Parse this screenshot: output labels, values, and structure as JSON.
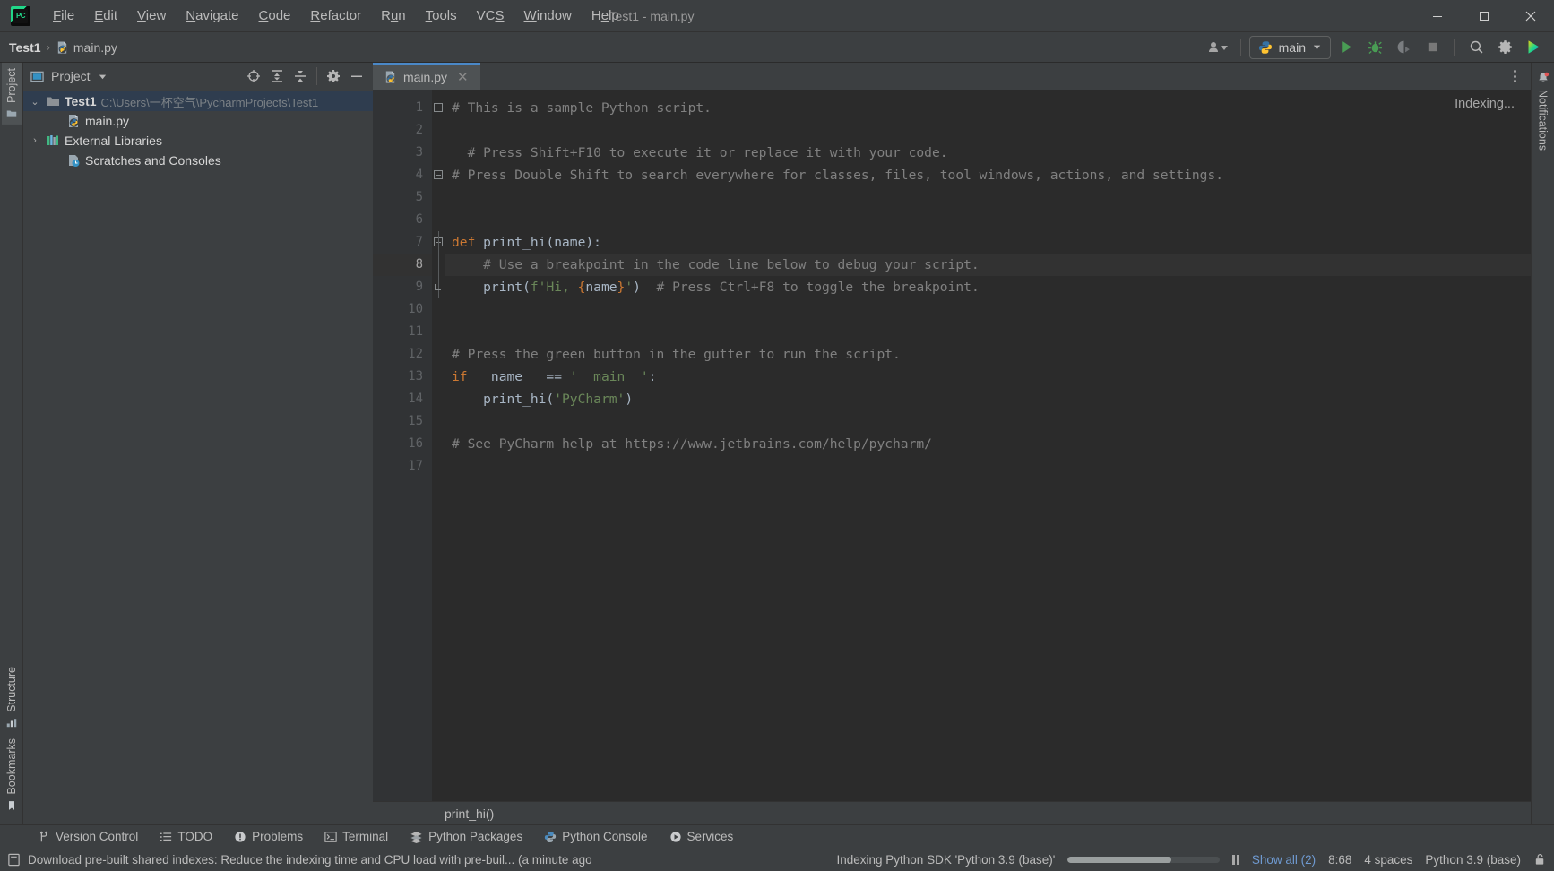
{
  "window": {
    "title": "Test1 - main.py",
    "minimize_label": "–",
    "maximize_label": "☐",
    "close_label": "✕",
    "logo_text": "PC"
  },
  "menu": {
    "items": [
      {
        "label": "File",
        "mnemonic": "F"
      },
      {
        "label": "Edit",
        "mnemonic": "E"
      },
      {
        "label": "View",
        "mnemonic": "V"
      },
      {
        "label": "Navigate",
        "mnemonic": "N"
      },
      {
        "label": "Code",
        "mnemonic": "C"
      },
      {
        "label": "Refactor",
        "mnemonic": "R"
      },
      {
        "label": "Run",
        "mnemonic": "u"
      },
      {
        "label": "Tools",
        "mnemonic": "T"
      },
      {
        "label": "VCS",
        "mnemonic": "S"
      },
      {
        "label": "Window",
        "mnemonic": "W"
      },
      {
        "label": "Help",
        "mnemonic": "H"
      }
    ]
  },
  "navbar": {
    "breadcrumb_project": "Test1",
    "breadcrumb_separator": "›",
    "breadcrumb_file": "main.py",
    "run_config": "main",
    "icons": {
      "account": "account-icon",
      "run": "run-icon",
      "debug": "debug-icon",
      "coverage": "run-with-coverage-icon",
      "stop": "stop-icon",
      "search": "search-everywhere-icon",
      "settings": "settings-icon",
      "updates": "ide-updates-icon"
    }
  },
  "left_stripe": {
    "tabs": [
      {
        "label": "Project",
        "active": true,
        "icon": "project-folder-icon"
      },
      {
        "label": "Structure",
        "active": false,
        "icon": "structure-icon"
      },
      {
        "label": "Bookmarks",
        "active": false,
        "icon": "bookmark-icon"
      }
    ]
  },
  "right_stripe": {
    "tabs": [
      {
        "label": "Notifications",
        "active": false,
        "icon": "bell-icon",
        "badge": true
      }
    ]
  },
  "project_panel": {
    "title": "Project",
    "dropdown_icon": "chevron-down-icon",
    "header_icons": [
      "select-opened-file-icon",
      "expand-all-icon",
      "collapse-all-icon",
      "gear-icon",
      "hide-icon"
    ],
    "tree": [
      {
        "name": "Test1",
        "path": "C:\\Users\\一杯空气\\PycharmProjects\\Test1",
        "arrow": "⌄",
        "selected": true,
        "bold": true,
        "indent": 0,
        "icon": "folder-icon"
      },
      {
        "name": "main.py",
        "path": "",
        "arrow": "",
        "selected": false,
        "bold": false,
        "indent": 1,
        "icon": "python-file-icon"
      },
      {
        "name": "External Libraries",
        "path": "",
        "arrow": "›",
        "selected": false,
        "bold": false,
        "indent": 0,
        "icon": "libraries-icon"
      },
      {
        "name": "Scratches and Consoles",
        "path": "",
        "arrow": "",
        "selected": false,
        "bold": false,
        "indent": 0,
        "icon": "scratches-icon"
      }
    ]
  },
  "editor": {
    "tab": {
      "label": "main.py",
      "close": "✕",
      "icon": "python-file-icon"
    },
    "indexing_text": "Indexing...",
    "bottom_breadcrumb": "print_hi()",
    "current_line": 8,
    "lines": [
      {
        "n": 1,
        "tokens": [
          {
            "t": "# This is a sample Python script.",
            "c": "cm"
          }
        ]
      },
      {
        "n": 2,
        "tokens": []
      },
      {
        "n": 3,
        "tokens": [
          {
            "t": "  # Press Shift+F10 to execute it or replace it with your code.",
            "c": "cm"
          }
        ]
      },
      {
        "n": 4,
        "tokens": [
          {
            "t": "# Press Double Shift to search everywhere for classes, files, tool windows, actions, and settings.",
            "c": "cm"
          }
        ]
      },
      {
        "n": 5,
        "tokens": []
      },
      {
        "n": 6,
        "tokens": []
      },
      {
        "n": 7,
        "tokens": [
          {
            "t": "def ",
            "c": "kw"
          },
          {
            "t": "print_hi",
            "c": "id"
          },
          {
            "t": "(name):",
            "c": "id"
          }
        ]
      },
      {
        "n": 8,
        "tokens": [
          {
            "t": "    # Use a breakpoint in the code line below to debug your script.",
            "c": "cm"
          }
        ]
      },
      {
        "n": 9,
        "tokens": [
          {
            "t": "    print(",
            "c": "id"
          },
          {
            "t": "f'Hi, ",
            "c": "st"
          },
          {
            "t": "{",
            "c": "br"
          },
          {
            "t": "name",
            "c": "id"
          },
          {
            "t": "}",
            "c": "br"
          },
          {
            "t": "'",
            "c": "st"
          },
          {
            "t": ")  ",
            "c": "id"
          },
          {
            "t": "# Press Ctrl+F8 to toggle the breakpoint.",
            "c": "cm"
          }
        ]
      },
      {
        "n": 10,
        "tokens": []
      },
      {
        "n": 11,
        "tokens": []
      },
      {
        "n": 12,
        "tokens": [
          {
            "t": "# Press the green button in the gutter to run the script.",
            "c": "cm"
          }
        ]
      },
      {
        "n": 13,
        "tokens": [
          {
            "t": "if ",
            "c": "kw"
          },
          {
            "t": "__name__ == ",
            "c": "id"
          },
          {
            "t": "'__main__'",
            "c": "st"
          },
          {
            "t": ":",
            "c": "id"
          }
        ]
      },
      {
        "n": 14,
        "tokens": [
          {
            "t": "    print_hi(",
            "c": "id"
          },
          {
            "t": "'PyCharm'",
            "c": "st"
          },
          {
            "t": ")",
            "c": "id"
          }
        ]
      },
      {
        "n": 15,
        "tokens": []
      },
      {
        "n": 16,
        "tokens": [
          {
            "t": "# See PyCharm help at https://www.jetbrains.com/help/pycharm/",
            "c": "cm"
          }
        ]
      },
      {
        "n": 17,
        "tokens": []
      }
    ]
  },
  "bottom_toolbar": {
    "items": [
      {
        "label": "Version Control",
        "icon": "vcs-branch-icon"
      },
      {
        "label": "TODO",
        "icon": "todo-list-icon"
      },
      {
        "label": "Problems",
        "icon": "problems-icon"
      },
      {
        "label": "Terminal",
        "icon": "terminal-icon"
      },
      {
        "label": "Python Packages",
        "icon": "packages-icon"
      },
      {
        "label": "Python Console",
        "icon": "python-console-icon"
      },
      {
        "label": "Services",
        "icon": "services-icon"
      }
    ]
  },
  "statusbar": {
    "notification_icon": "event-log-icon",
    "message": "Download pre-built shared indexes: Reduce the indexing time and CPU load with pre-buil... (a minute ago",
    "progress_label": "Indexing Python SDK 'Python 3.9 (base)'",
    "progress_percent": 68,
    "pause_icon": "pause-icon",
    "show_all": "Show all (2)",
    "caret_position": "8:68",
    "indent": "4 spaces",
    "interpreter": "Python 3.9 (base)",
    "lock_icon": "write-access-icon"
  },
  "colors": {
    "panel_bg": "#3c3f41",
    "editor_bg": "#2b2b2b",
    "gutter_bg": "#313335",
    "selection_bg": "#2f3d4f",
    "accent_blue": "#4a88c7",
    "keyword_orange": "#cc7832",
    "string_green": "#6a8759",
    "comment_grey": "#808080",
    "text_default": "#a9b7c6",
    "link_blue": "#6f9ad1",
    "run_green": "#499c54"
  }
}
